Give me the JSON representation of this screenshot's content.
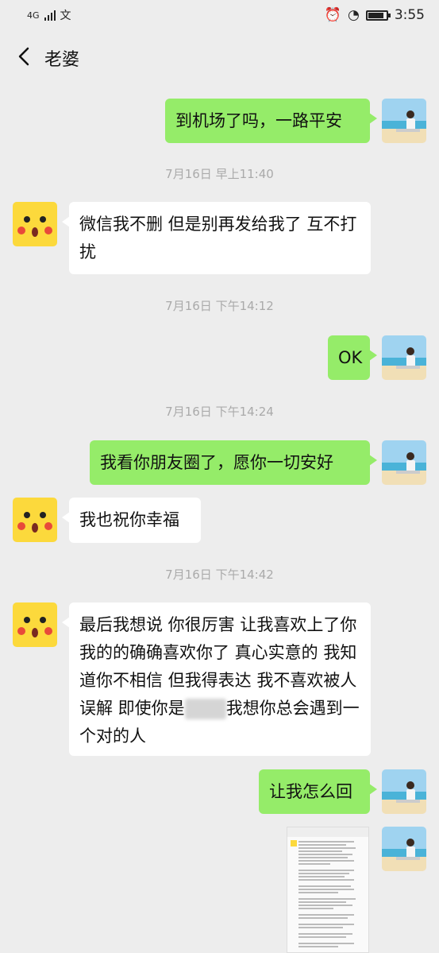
{
  "status_bar": {
    "network": "4G",
    "time": "3:55",
    "battery_level": 0.85
  },
  "header": {
    "title": "老婆"
  },
  "messages": {
    "m1": "到机场了吗，一路平安",
    "t1": "7月16日 早上11:40",
    "m2": "微信我不删 但是别再发给我了 互不打扰",
    "t2": "7月16日 下午14:12",
    "m3": "OK",
    "t3": "7月16日 下午14:24",
    "m4": "我看你朋友圈了，愿你一切安好",
    "m5": "我也祝你幸福",
    "t4": "7月16日 下午14:42",
    "m6_part1": "最后我想说 你很厉害 让我喜欢上了你 我的的确确喜欢你了 真心实意的 我知道你不相信 但我得表达 我不喜欢被人误解 即使你是",
    "m6_part2": "我想你总会遇到一个对的人",
    "m7": "让我怎么回"
  },
  "colors": {
    "background": "#ededed",
    "my_bubble": "#95ec69",
    "other_bubble": "#ffffff",
    "timestamp": "#aaaaaa"
  },
  "icons": {
    "back": "chevron-left-icon",
    "self_avatar": "beach-photo-avatar",
    "contact_avatar": "pikachu-avatar"
  }
}
